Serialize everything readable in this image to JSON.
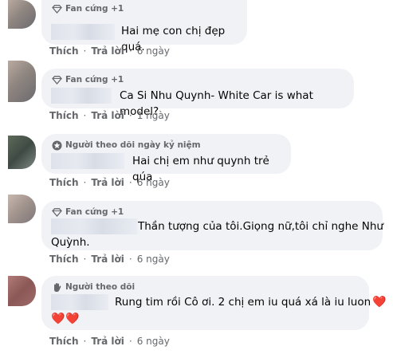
{
  "comments": [
    {
      "badge_icon": "diamond-icon",
      "badge_text": "Fan cứng +1",
      "text": "Hai mẹ con chị đẹp quá.",
      "actions": {
        "like": "Thích",
        "reply": "Trả lời",
        "time": "6 ngày"
      }
    },
    {
      "badge_icon": "diamond-icon",
      "badge_text": "Fan cứng +1",
      "text": "Ca Si Nhu Quynh- White Car is what model?",
      "actions": {
        "like": "Thích",
        "reply": "Trả lời",
        "time": "1 ngày"
      }
    },
    {
      "badge_icon": "calendar-badge-icon",
      "badge_text": "Người theo dõi ngày kỷ niệm",
      "text": "Hai chị em như quynh trẻ qúa",
      "actions": {
        "like": "Thích",
        "reply": "Trả lời",
        "time": "6 ngày"
      }
    },
    {
      "badge_icon": "diamond-icon",
      "badge_text": "Fan cứng +1",
      "text_line1": "Thần tượng của tôi.Giọng nữ,tôi chỉ nghe Như",
      "text_line2": "Quỳnh.",
      "actions": {
        "like": "Thích",
        "reply": "Trả lời",
        "time": "6 ngày"
      }
    },
    {
      "badge_icon": "waving-hand-icon",
      "badge_text": "Người theo dõi",
      "text_line1": "Rung tim rồi Cô ơi. 2 chị em iu quá xá là iu luon",
      "hearts_line1": "❤️",
      "hearts_line2": "❤️❤️",
      "actions": {
        "like": "Thích",
        "reply": "Trả lời",
        "time": "6 ngày"
      }
    }
  ]
}
